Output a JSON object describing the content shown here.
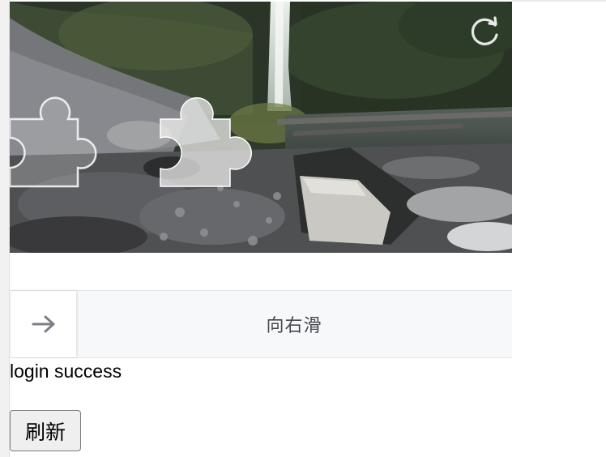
{
  "captcha": {
    "refresh_icon": "refresh-icon",
    "slider": {
      "hint": "向右滑",
      "handle_icon": "arrow-right-icon",
      "progress": 0
    },
    "colors": {
      "track_bg": "#f7f8fa",
      "handle_bg": "#ffffff",
      "arrow": "#7c7f84"
    }
  },
  "status": {
    "message": "login success"
  },
  "actions": {
    "refresh_label": "刷新"
  }
}
